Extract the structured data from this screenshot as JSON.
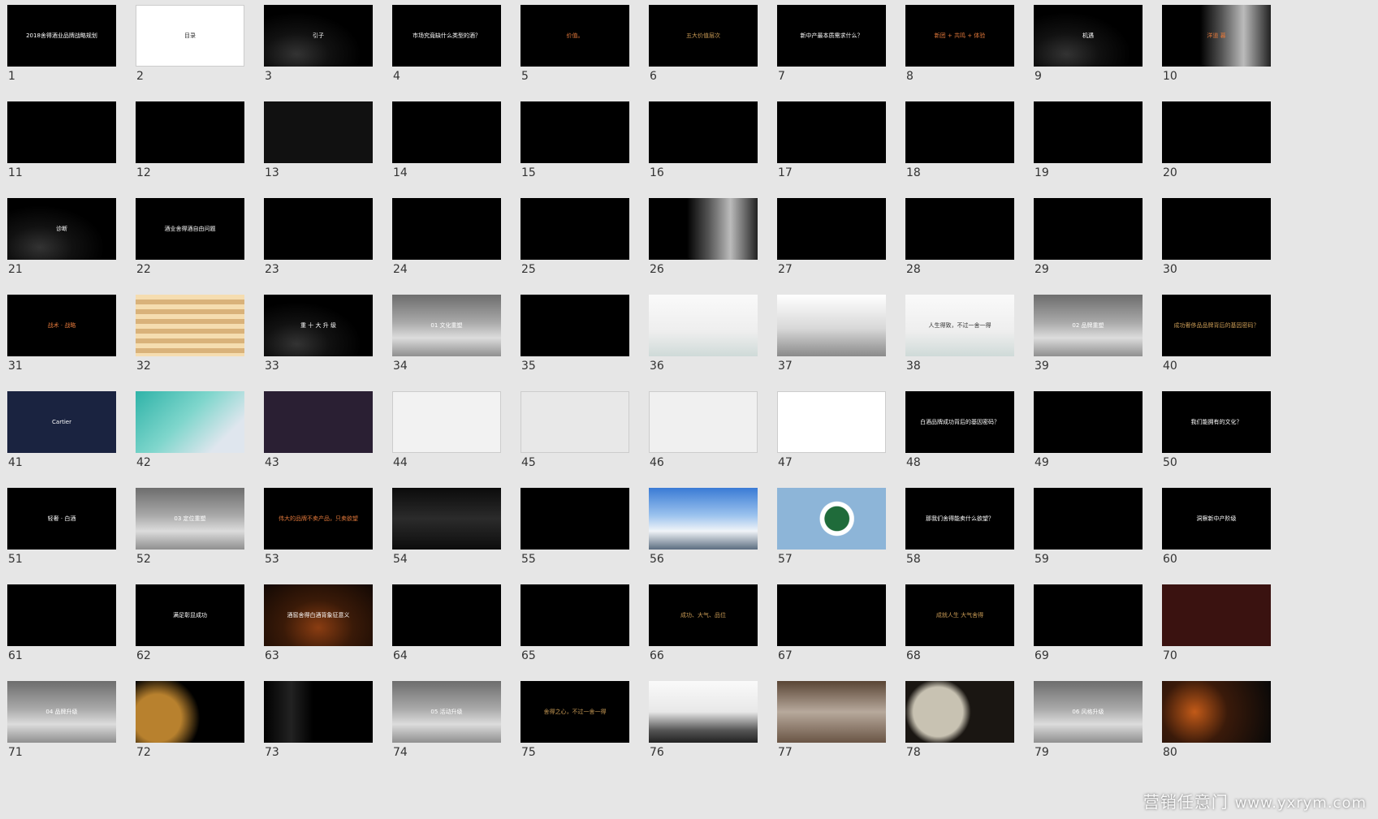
{
  "slides": [
    {
      "n": "1",
      "t": "2018舍得酒业品牌战略规划",
      "bg": "#000",
      "c": ""
    },
    {
      "n": "2",
      "t": "目录",
      "bg": "#fff",
      "c": "dark"
    },
    {
      "n": "3",
      "t": "引子",
      "bg": "rocks",
      "c": ""
    },
    {
      "n": "4",
      "t": "市场究竟缺什么类型的酒？",
      "bg": "#000",
      "c": ""
    },
    {
      "n": "5",
      "t": "价值。",
      "bg": "#000",
      "c": "accent"
    },
    {
      "n": "6",
      "t": "五大价值层次",
      "bg": "#000",
      "c": "gold"
    },
    {
      "n": "7",
      "t": "新中产最本质需求什么？",
      "bg": "#000",
      "c": ""
    },
    {
      "n": "8",
      "t": "新团 + 共鸣 + 体验",
      "bg": "#000",
      "c": "accent"
    },
    {
      "n": "9",
      "t": "机遇",
      "bg": "rocks",
      "c": ""
    },
    {
      "n": "10",
      "t": "洋道 暮",
      "bg": "person",
      "c": "accent"
    },
    {
      "n": "11",
      "t": "",
      "bg": "#000",
      "c": ""
    },
    {
      "n": "12",
      "t": "",
      "bg": "#000",
      "c": ""
    },
    {
      "n": "13",
      "t": "",
      "bg": "#111",
      "c": ""
    },
    {
      "n": "14",
      "t": "",
      "bg": "#000",
      "c": ""
    },
    {
      "n": "15",
      "t": "",
      "bg": "#000",
      "c": ""
    },
    {
      "n": "16",
      "t": "",
      "bg": "#000",
      "c": ""
    },
    {
      "n": "17",
      "t": "",
      "bg": "#000",
      "c": ""
    },
    {
      "n": "18",
      "t": "",
      "bg": "#000",
      "c": ""
    },
    {
      "n": "19",
      "t": "",
      "bg": "#000",
      "c": ""
    },
    {
      "n": "20",
      "t": "",
      "bg": "#000",
      "c": ""
    },
    {
      "n": "21",
      "t": "诊断",
      "bg": "rocks",
      "c": ""
    },
    {
      "n": "22",
      "t": "酒业舍得酒自由问题",
      "bg": "#000",
      "c": ""
    },
    {
      "n": "23",
      "t": "",
      "bg": "#000",
      "c": ""
    },
    {
      "n": "24",
      "t": "",
      "bg": "#000",
      "c": ""
    },
    {
      "n": "25",
      "t": "",
      "bg": "#000",
      "c": ""
    },
    {
      "n": "26",
      "t": "",
      "bg": "person",
      "c": ""
    },
    {
      "n": "27",
      "t": "",
      "bg": "#000",
      "c": ""
    },
    {
      "n": "28",
      "t": "",
      "bg": "#000",
      "c": ""
    },
    {
      "n": "29",
      "t": "",
      "bg": "#000",
      "c": ""
    },
    {
      "n": "30",
      "t": "",
      "bg": "#000",
      "c": ""
    },
    {
      "n": "31",
      "t": "战术 · 战略",
      "bg": "#000",
      "c": "accent"
    },
    {
      "n": "32",
      "t": "",
      "bg": "beige",
      "c": "dark"
    },
    {
      "n": "33",
      "t": "重 十 大 升 级",
      "bg": "rocks",
      "c": ""
    },
    {
      "n": "34",
      "t": "01 文化重塑",
      "bg": "mist",
      "c": ""
    },
    {
      "n": "35",
      "t": "",
      "bg": "#000",
      "c": ""
    },
    {
      "n": "36",
      "t": "",
      "bg": "paint",
      "c": "dark"
    },
    {
      "n": "37",
      "t": "",
      "bg": "pier",
      "c": "dark"
    },
    {
      "n": "38",
      "t": "人生得致，不过一舍一得",
      "bg": "paint",
      "c": "dark"
    },
    {
      "n": "39",
      "t": "02 品牌重塑",
      "bg": "mist",
      "c": ""
    },
    {
      "n": "40",
      "t": "成功奢侈品品牌背后的基因密码？",
      "bg": "#000",
      "c": "gold"
    },
    {
      "n": "41",
      "t": "Cartier",
      "bg": "#1a2340",
      "c": ""
    },
    {
      "n": "42",
      "t": "",
      "bg": "tiffany",
      "c": ""
    },
    {
      "n": "43",
      "t": "",
      "bg": "#2a1f33",
      "c": ""
    },
    {
      "n": "44",
      "t": "",
      "bg": "#f2f2f2",
      "c": "dark"
    },
    {
      "n": "45",
      "t": "",
      "bg": "#e8e8e8",
      "c": "dark"
    },
    {
      "n": "46",
      "t": "",
      "bg": "#f0f0f0",
      "c": "dark"
    },
    {
      "n": "47",
      "t": "",
      "bg": "#fff",
      "c": "dark"
    },
    {
      "n": "48",
      "t": "白酒品牌成功背后的基因密码？",
      "bg": "#000",
      "c": ""
    },
    {
      "n": "49",
      "t": "",
      "bg": "#000",
      "c": ""
    },
    {
      "n": "50",
      "t": "我们能拥有的文化？",
      "bg": "#000",
      "c": ""
    },
    {
      "n": "51",
      "t": "轻奢 · 白酒",
      "bg": "#000",
      "c": ""
    },
    {
      "n": "52",
      "t": "03 定位重塑",
      "bg": "mist",
      "c": ""
    },
    {
      "n": "53",
      "t": "伟大的品牌不卖产品，只卖欲望",
      "bg": "#000",
      "c": "accent"
    },
    {
      "n": "54",
      "t": "",
      "bg": "car",
      "c": ""
    },
    {
      "n": "55",
      "t": "",
      "bg": "#000",
      "c": ""
    },
    {
      "n": "56",
      "t": "",
      "bg": "mountain",
      "c": ""
    },
    {
      "n": "57",
      "t": "",
      "bg": "starbucks",
      "c": ""
    },
    {
      "n": "58",
      "t": "那我们舍得能卖什么欲望？",
      "bg": "#000",
      "c": ""
    },
    {
      "n": "59",
      "t": "",
      "bg": "#000",
      "c": ""
    },
    {
      "n": "60",
      "t": "洞察新中产阶级",
      "bg": "#000",
      "c": ""
    },
    {
      "n": "61",
      "t": "",
      "bg": "#000",
      "c": ""
    },
    {
      "n": "62",
      "t": "满足彰显成功",
      "bg": "#000",
      "c": ""
    },
    {
      "n": "63",
      "t": "酒窖舍得白酒背象征意义",
      "bg": "cellar",
      "c": ""
    },
    {
      "n": "64",
      "t": "",
      "bg": "#000",
      "c": ""
    },
    {
      "n": "65",
      "t": "",
      "bg": "#000",
      "c": ""
    },
    {
      "n": "66",
      "t": "成功、大气、品位",
      "bg": "#000",
      "c": "gold"
    },
    {
      "n": "67",
      "t": "",
      "bg": "#000",
      "c": ""
    },
    {
      "n": "68",
      "t": "成就人生 大气舍得",
      "bg": "#000",
      "c": "gold"
    },
    {
      "n": "69",
      "t": "",
      "bg": "#000",
      "c": ""
    },
    {
      "n": "70",
      "t": "",
      "bg": "#3a1210",
      "c": ""
    },
    {
      "n": "71",
      "t": "04 品牌升级",
      "bg": "mist",
      "c": ""
    },
    {
      "n": "72",
      "t": "",
      "bg": "lion",
      "c": ""
    },
    {
      "n": "73",
      "t": "",
      "bg": "suit",
      "c": ""
    },
    {
      "n": "74",
      "t": "05 活动升级",
      "bg": "mist",
      "c": ""
    },
    {
      "n": "75",
      "t": "舍得之心，不过一舍一得",
      "bg": "#000",
      "c": "gold"
    },
    {
      "n": "76",
      "t": "",
      "bg": "jars",
      "c": "dark"
    },
    {
      "n": "77",
      "t": "",
      "bg": "steam",
      "c": ""
    },
    {
      "n": "78",
      "t": "",
      "bg": "coin",
      "c": ""
    },
    {
      "n": "79",
      "t": "06 风格升级",
      "bg": "mist",
      "c": ""
    },
    {
      "n": "80",
      "t": "",
      "bg": "tech",
      "c": ""
    }
  ],
  "watermark": {
    "text": "营销任意门",
    "url": "www.yxrym.com"
  }
}
